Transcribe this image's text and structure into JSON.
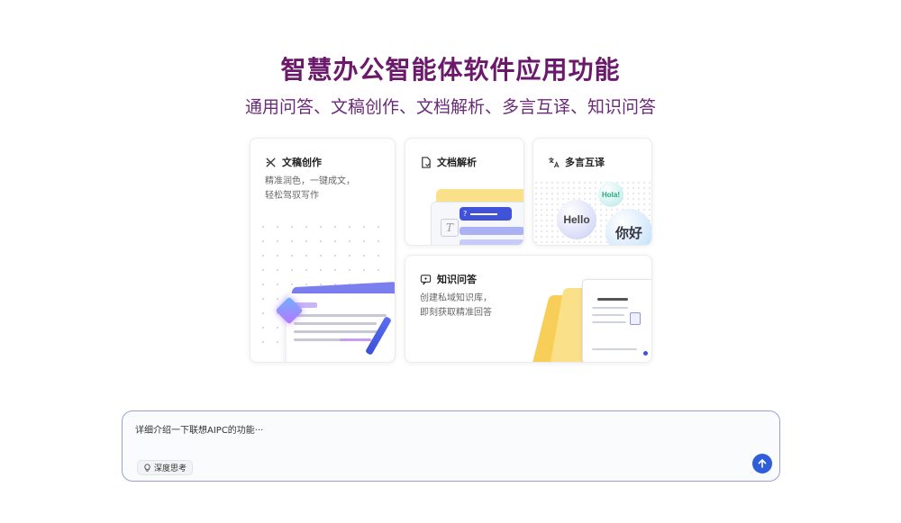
{
  "header": {
    "title": "智慧办公智能体软件应用功能",
    "subtitle": "通用问答、文稿创作、文档解析、多言互译、知识问答"
  },
  "cards": {
    "writing": {
      "title": "文稿创作",
      "desc_line1": "精准润色，一键成文，",
      "desc_line2": "轻松驾驭写作",
      "icon": "writing-icon"
    },
    "doc": {
      "title": "文档解析",
      "icon": "document-icon"
    },
    "translate": {
      "title": "多言互译",
      "icon": "translate-icon",
      "bubble_hello": "Hello",
      "bubble_hola": "Hola!",
      "bubble_nihao": "你好"
    },
    "qa": {
      "title": "知识问答",
      "desc_line1": "创建私域知识库，",
      "desc_line2": "即刻获取精准回答",
      "icon": "chat-icon"
    }
  },
  "input": {
    "value": "详细介绍一下联想AIPC的功能···",
    "deep_think_label": "深度思考",
    "send_icon": "arrow-up-icon"
  },
  "colors": {
    "title": "#6b1a6b",
    "accent": "#2f5fd8",
    "input_border": "#9aa0d4"
  }
}
